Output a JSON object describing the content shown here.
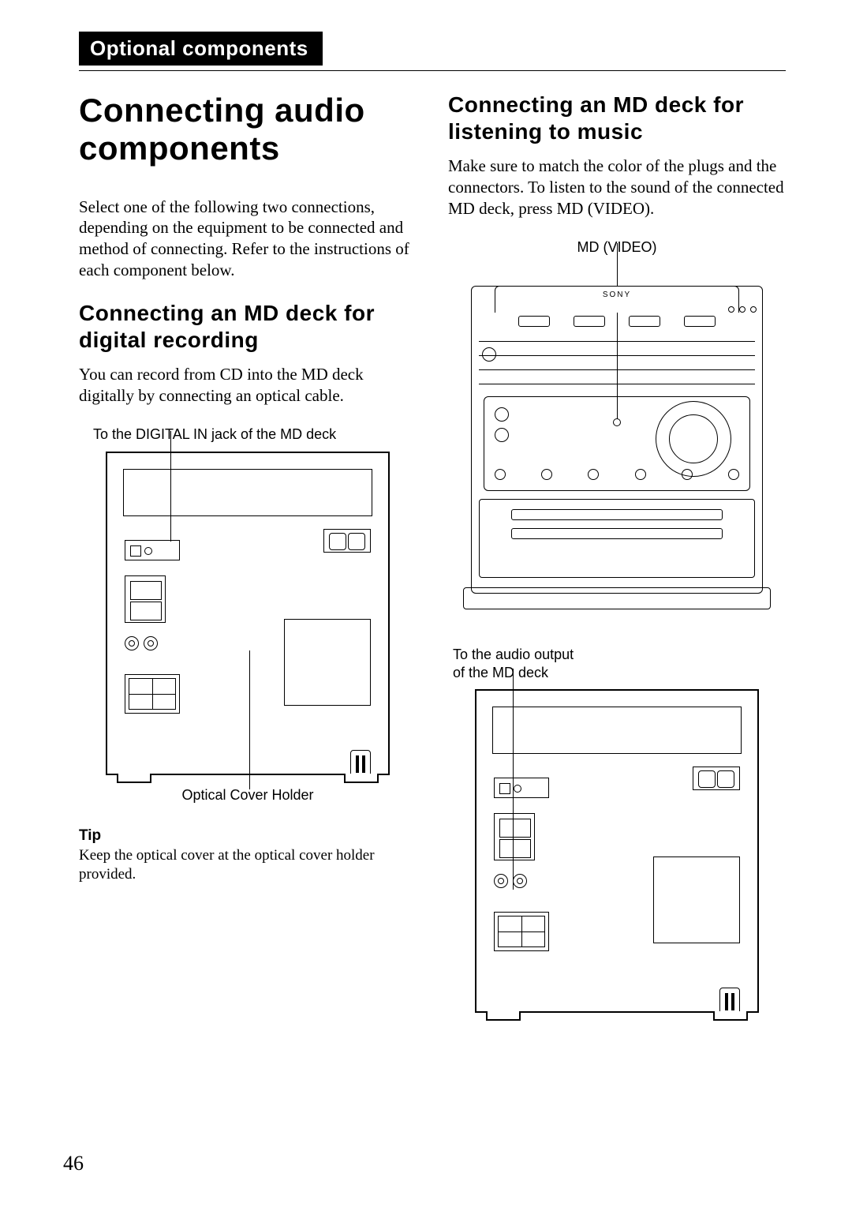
{
  "header": {
    "section": "Optional components"
  },
  "left": {
    "title": "Connecting audio components",
    "intro": "Select one of the following two connections, depending on the equipment to be connected and method of connecting. Refer to the instructions of each component below.",
    "sub1": "Connecting an MD deck for digital recording",
    "p1": "You can record from CD into the MD deck digitally by connecting an optical cable.",
    "caption_top": "To the DIGITAL IN jack of the MD deck",
    "caption_bottom": "Optical Cover Holder",
    "tip_label": "Tip",
    "tip_text": "Keep the optical cover at the optical cover holder provided."
  },
  "right": {
    "sub1": "Connecting an MD deck for listening to music",
    "p1": "Make sure to match the color of the plugs and the connectors. To listen to the sound of the connected MD deck, press MD (VIDEO).",
    "caption_top": "MD (VIDEO)",
    "brand": "SONY",
    "caption_mid": "To the audio output\nof the MD deck"
  },
  "footer": {
    "page": "46"
  }
}
